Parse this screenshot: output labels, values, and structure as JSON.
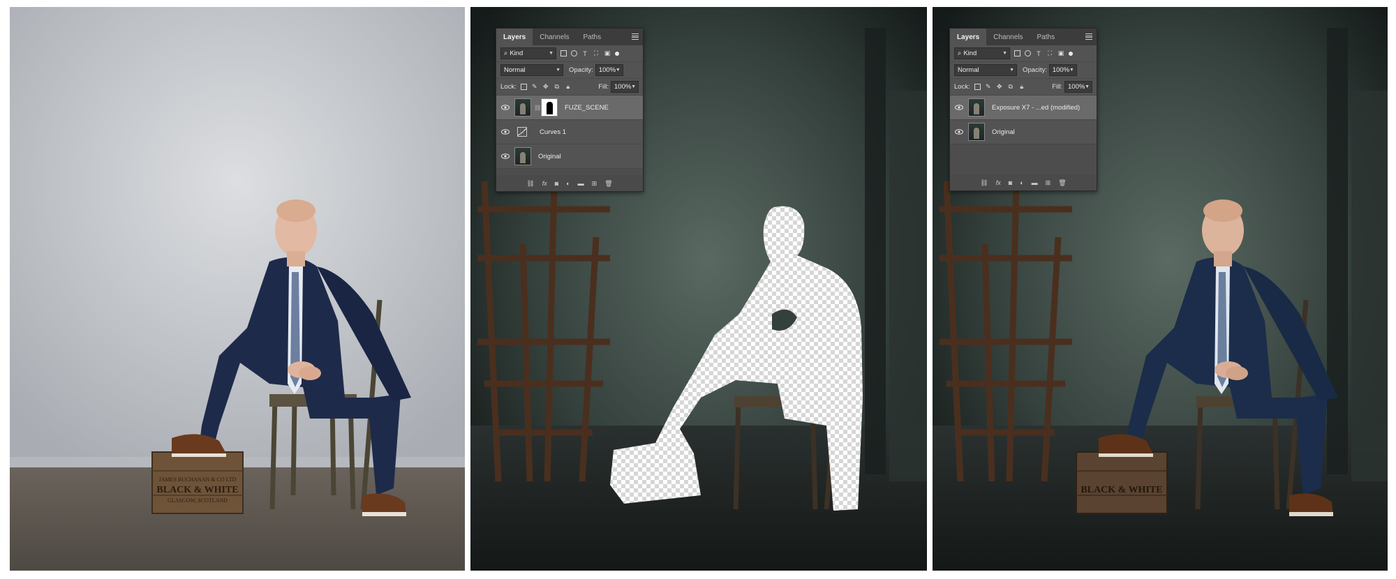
{
  "panel_before": {
    "name": "original-photo"
  },
  "panel_mask": {
    "layers_panel": {
      "tabs": [
        "Layers",
        "Channels",
        "Paths"
      ],
      "filter_kind": "Kind",
      "blend_mode": "Normal",
      "opacity_label": "Opacity:",
      "opacity_value": "100%",
      "lock_label": "Lock:",
      "fill_label": "Fill:",
      "fill_value": "100%",
      "layers": [
        {
          "name": "FUZE_SCENE",
          "visible": true,
          "selected": true,
          "has_mask": true
        },
        {
          "name": "Curves 1",
          "visible": true,
          "selected": false,
          "type": "adjustment"
        },
        {
          "name": "Original",
          "visible": true,
          "selected": false
        }
      ]
    }
  },
  "panel_after": {
    "layers_panel": {
      "tabs": [
        "Layers",
        "Channels",
        "Paths"
      ],
      "filter_kind": "Kind",
      "blend_mode": "Normal",
      "opacity_label": "Opacity:",
      "opacity_value": "100%",
      "lock_label": "Lock:",
      "fill_label": "Fill:",
      "fill_value": "100%",
      "layers": [
        {
          "name": "Exposure X7 - ...ed (modified)",
          "visible": true,
          "selected": true
        },
        {
          "name": "Original",
          "visible": true,
          "selected": false
        }
      ]
    }
  },
  "crate": {
    "line1": "JAMES BUCHANAN & CO LTD",
    "line2": "BLACK & WHITE",
    "line3": "GLASGOW, SCOTLAND"
  },
  "colors": {
    "panel_bg": "#535353",
    "panel_tabbar": "#3c3c3c",
    "selected_layer": "#6a6a6a",
    "grey_backdrop": "#c7c9cc",
    "dark_backdrop": "#3d4a46"
  }
}
